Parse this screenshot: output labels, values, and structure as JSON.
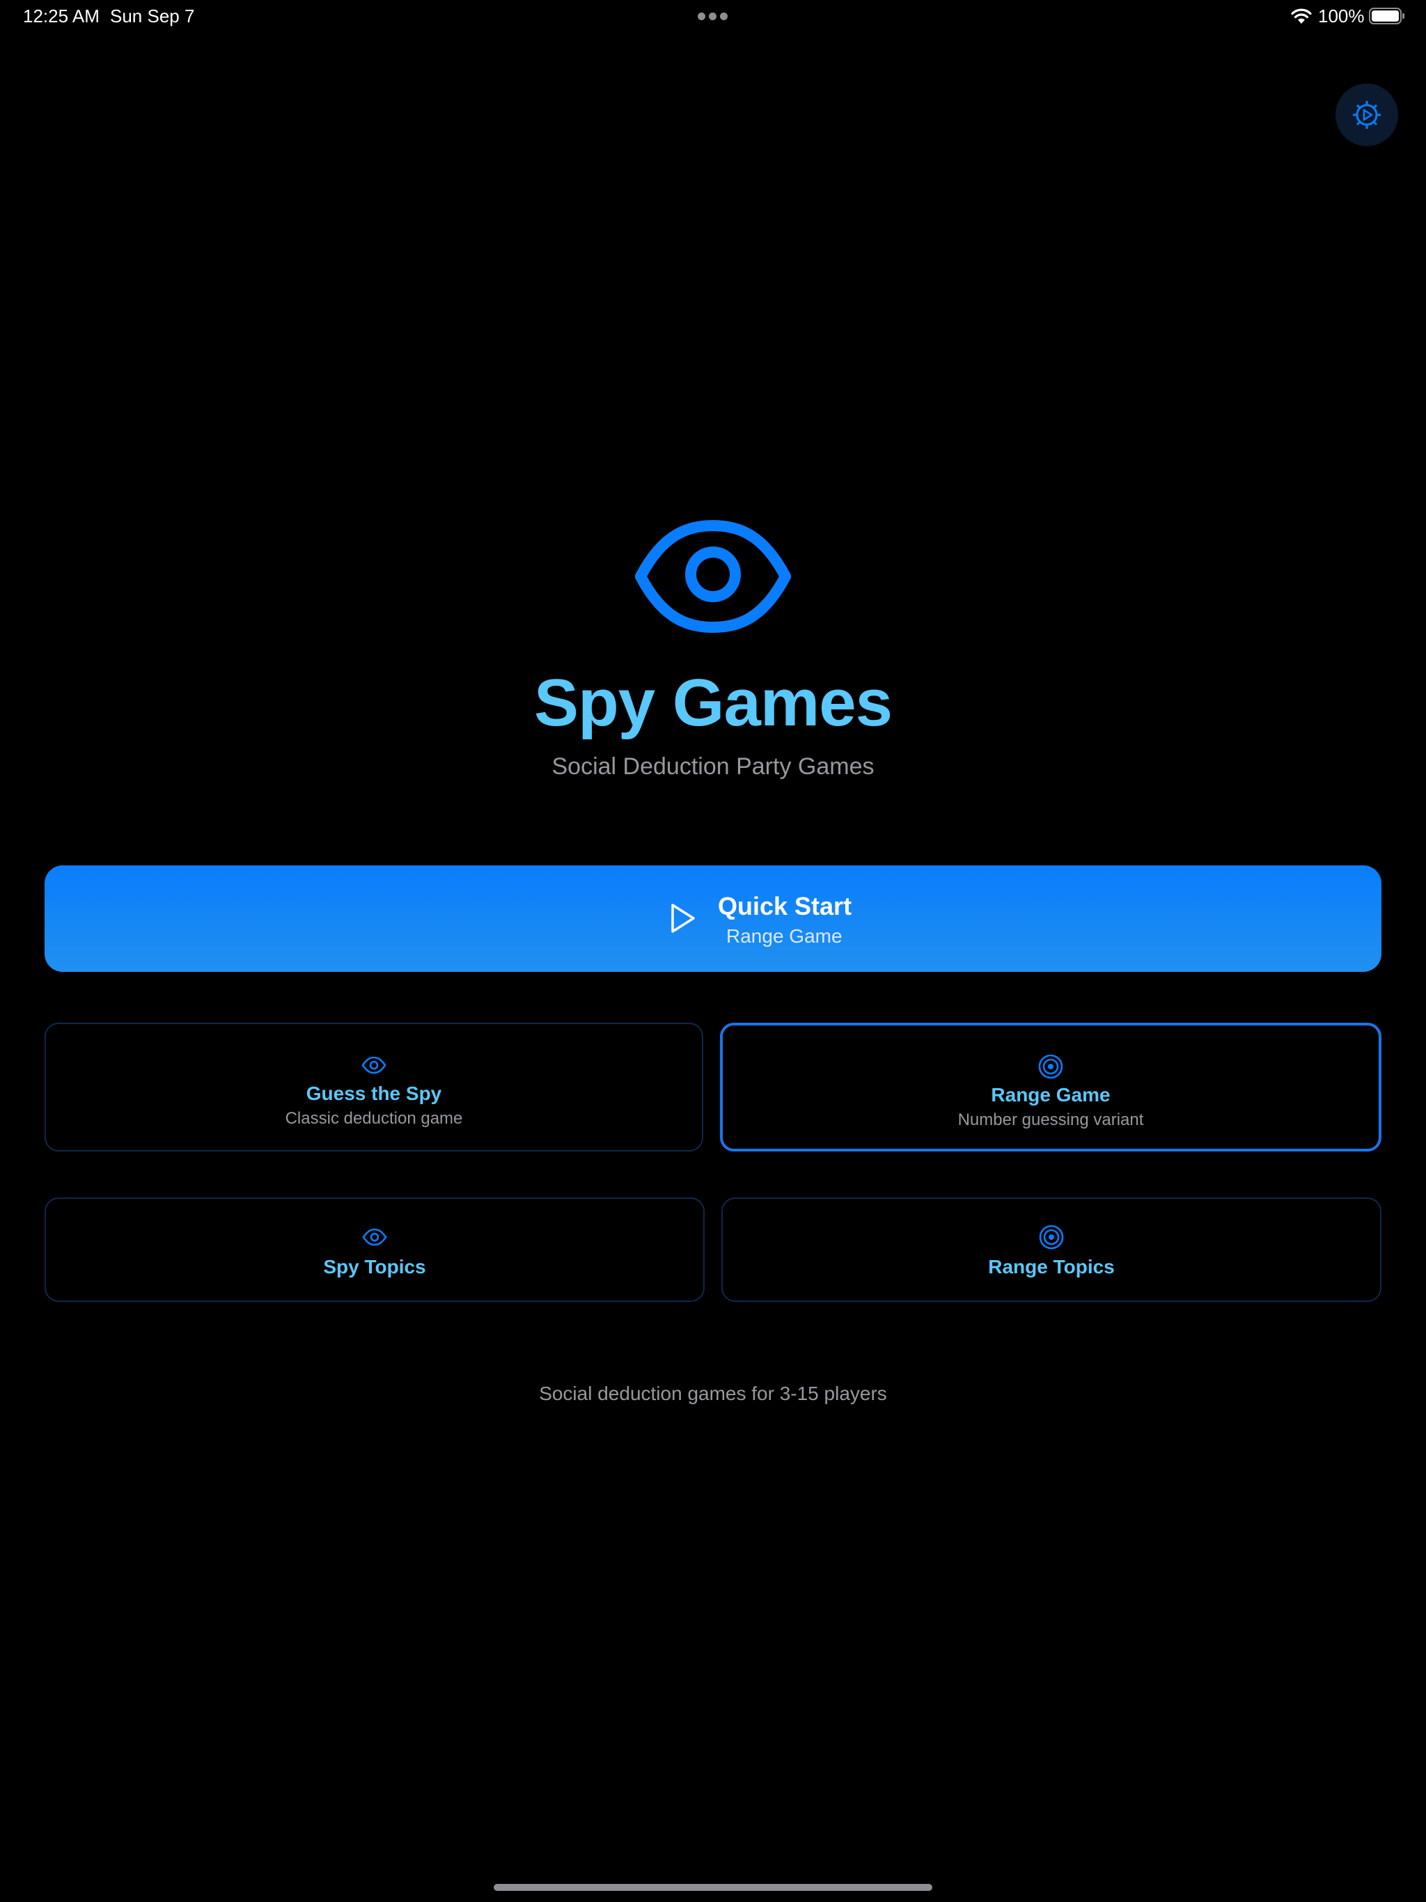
{
  "status_bar": {
    "time": "12:25 AM",
    "date": "Sun Sep 7",
    "battery": "100%",
    "wifi_icon": "wifi-icon",
    "battery_icon": "battery-full-icon"
  },
  "settings": {
    "icon": "gear-icon"
  },
  "hero": {
    "icon": "eye-icon",
    "title": "Spy Games",
    "subtitle": "Social Deduction Party Games"
  },
  "quick_start": {
    "icon": "play-icon",
    "title": "Quick Start",
    "subtitle": "Range Game"
  },
  "modes": [
    {
      "title": "Guess the Spy",
      "subtitle": "Classic deduction game",
      "icon": "eye-icon",
      "selected": false
    },
    {
      "title": "Range Game",
      "subtitle": "Number guessing variant",
      "icon": "target-icon",
      "selected": true
    }
  ],
  "topics": [
    {
      "title": "Spy Topics",
      "icon": "eye-icon"
    },
    {
      "title": "Range Topics",
      "icon": "target-icon"
    }
  ],
  "footer": {
    "note": "Social deduction games for 3-15 players"
  },
  "colors": {
    "accent": "#0a7dfc",
    "title": "#5ac8fa",
    "secondary_text": "#98989f",
    "background": "#000000"
  }
}
